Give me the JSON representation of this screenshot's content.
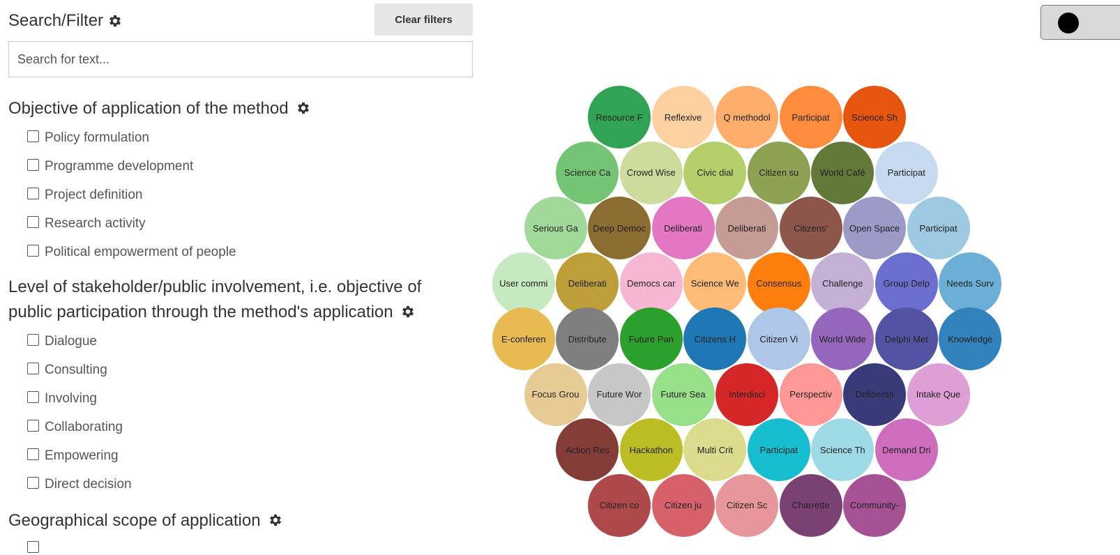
{
  "filter_panel": {
    "title": "Search/Filter",
    "clear_filters_label": "Clear filters",
    "search_placeholder": "Search for text...",
    "sections": [
      {
        "heading": "Objective of application of the method",
        "options": [
          "Policy formulation",
          "Programme development",
          "Project definition",
          "Research activity",
          "Political empowerment of people"
        ]
      },
      {
        "heading": "Level of stakeholder/public involvement, i.e. objective of public participation through the method's application",
        "options": [
          "Dialogue",
          "Consulting",
          "Involving",
          "Collaborating",
          "Empowering",
          "Direct decision"
        ]
      },
      {
        "heading": "Geographical scope of application",
        "options": []
      }
    ],
    "settings_icon": "gear-icon"
  },
  "toggle": {
    "icon": "black-circle-knob"
  },
  "bubbles": {
    "rows": [
      [
        {
          "label": "Resource F",
          "color": "#31a354"
        },
        {
          "label": "Reflexive",
          "color": "#fdd0a2"
        },
        {
          "label": "Q methodol",
          "color": "#fdae6b"
        },
        {
          "label": "Participat",
          "color": "#fd8d3c"
        },
        {
          "label": "Science Sh",
          "color": "#e6550d"
        }
      ],
      [
        {
          "label": "Science Ca",
          "color": "#74c476"
        },
        {
          "label": "Crowd Wise",
          "color": "#cedb9c"
        },
        {
          "label": "Civic dial",
          "color": "#b5cf6b"
        },
        {
          "label": "Citizen su",
          "color": "#8ca252"
        },
        {
          "label": "World Café",
          "color": "#637939"
        },
        {
          "label": "Participat",
          "color": "#c6dbef"
        }
      ],
      [
        {
          "label": "Serious Ga",
          "color": "#a1d99b"
        },
        {
          "label": "Deep Democ",
          "color": "#8c6d31"
        },
        {
          "label": "Deliberati",
          "color": "#e377c2"
        },
        {
          "label": "Deliberati",
          "color": "#c49c94"
        },
        {
          "label": "Citizens'",
          "color": "#8c564b"
        },
        {
          "label": "Open Space",
          "color": "#9e9ac8"
        },
        {
          "label": "Participat",
          "color": "#9ecae1"
        }
      ],
      [
        {
          "label": "User commi",
          "color": "#c7e9c0"
        },
        {
          "label": "Deliberati",
          "color": "#bd9e39"
        },
        {
          "label": "Democs car",
          "color": "#f7b6d2"
        },
        {
          "label": "Science We",
          "color": "#ffbb78"
        },
        {
          "label": "Consensus",
          "color": "#ff7f0e"
        },
        {
          "label": "Challenge",
          "color": "#c5b0d5"
        },
        {
          "label": "Group Delp",
          "color": "#6b6ecf"
        },
        {
          "label": "Needs Surv",
          "color": "#6baed6"
        }
      ],
      [
        {
          "label": "E-conferen",
          "color": "#e7ba52"
        },
        {
          "label": "Distribute",
          "color": "#7f7f7f"
        },
        {
          "label": "Future Pan",
          "color": "#2ca02c"
        },
        {
          "label": "Citizens H",
          "color": "#1f77b4"
        },
        {
          "label": "Citizen Vi",
          "color": "#aec7e8"
        },
        {
          "label": "World Wide",
          "color": "#9467bd"
        },
        {
          "label": "Delphi Met",
          "color": "#5254a3"
        },
        {
          "label": "Knowledge",
          "color": "#3182bd"
        }
      ],
      [
        {
          "label": "Focus Grou",
          "color": "#e7cb94"
        },
        {
          "label": "Future Wor",
          "color": "#c7c7c7"
        },
        {
          "label": "Future Sea",
          "color": "#98df8a"
        },
        {
          "label": "Interdisci",
          "color": "#d62728"
        },
        {
          "label": "Perspectiv",
          "color": "#ff9896"
        },
        {
          "label": "Deliberati",
          "color": "#393b79"
        },
        {
          "label": "Intake Que",
          "color": "#de9ed6"
        }
      ],
      [
        {
          "label": "Action Res",
          "color": "#843c39"
        },
        {
          "label": "Hackathon",
          "color": "#bcbd22"
        },
        {
          "label": "Multi Crit",
          "color": "#dbdb8d"
        },
        {
          "label": "Participat",
          "color": "#17becf"
        },
        {
          "label": "Science Th",
          "color": "#9edae5"
        },
        {
          "label": "Demand Dri",
          "color": "#ce6dbd"
        }
      ],
      [
        {
          "label": "Citizen co",
          "color": "#ad494a"
        },
        {
          "label": "Citizen ju",
          "color": "#d6616b"
        },
        {
          "label": "Citizen Sc",
          "color": "#e7969c"
        },
        {
          "label": "Charrette",
          "color": "#7b4173"
        },
        {
          "label": "Community-",
          "color": "#a55194"
        }
      ]
    ]
  }
}
